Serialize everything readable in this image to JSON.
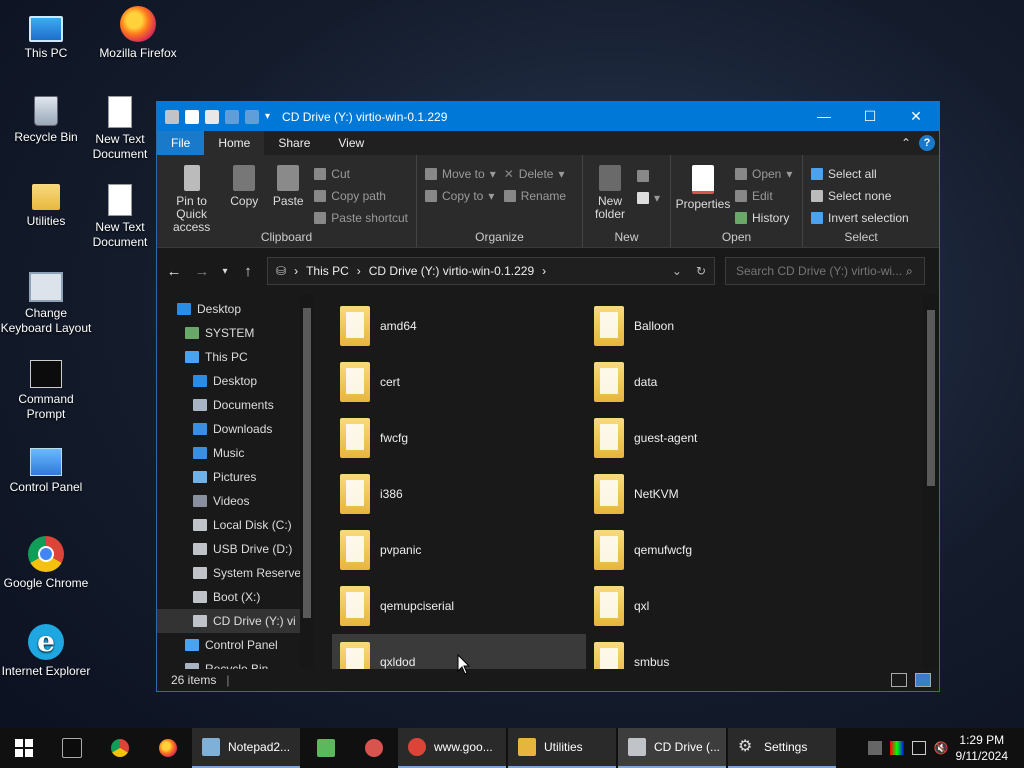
{
  "desktop": {
    "icons": [
      {
        "label": "This PC",
        "icon": "computer-icon"
      },
      {
        "label": "Mozilla Firefox",
        "icon": "firefox-icon"
      },
      {
        "label": "Recycle Bin",
        "icon": "recycle-bin-icon"
      },
      {
        "label": "New Text Document",
        "icon": "text-document-icon"
      },
      {
        "label": "Utilities",
        "icon": "folder-icon"
      },
      {
        "label": "New Text Document",
        "icon": "text-document-icon"
      },
      {
        "label": "Change Keyboard Layout",
        "icon": "keyboard-settings-icon"
      },
      {
        "label": "Command Prompt",
        "icon": "command-prompt-icon"
      },
      {
        "label": "Control Panel",
        "icon": "control-panel-icon"
      },
      {
        "label": "Google Chrome",
        "icon": "chrome-icon"
      },
      {
        "label": "Internet Explorer",
        "icon": "internet-explorer-icon"
      }
    ]
  },
  "window": {
    "title": "CD Drive (Y:) virtio-win-0.1.229",
    "tabs": [
      "File",
      "Home",
      "Share",
      "View"
    ],
    "help": "?",
    "ribbon": {
      "clipboard": {
        "label": "Clipboard",
        "pin": "Pin to Quick access",
        "copy": "Copy",
        "paste": "Paste",
        "cut": "Cut",
        "copy_path": "Copy path",
        "paste_shortcut": "Paste shortcut"
      },
      "organize": {
        "label": "Organize",
        "move_to": "Move to",
        "copy_to": "Copy to",
        "delete": "Delete",
        "rename": "Rename"
      },
      "new": {
        "label": "New",
        "new_folder": "New folder"
      },
      "open": {
        "label": "Open",
        "properties": "Properties",
        "open": "Open",
        "edit": "Edit",
        "history": "History"
      },
      "select": {
        "label": "Select",
        "select_all": "Select all",
        "select_none": "Select none",
        "invert": "Invert selection"
      }
    },
    "address": {
      "path": [
        "This PC",
        "CD Drive (Y:) virtio-win-0.1.229"
      ],
      "search_placeholder": "Search CD Drive (Y:) virtio-wi..."
    },
    "nav": [
      {
        "label": "Desktop",
        "level": 0,
        "color": "#2b8ce6"
      },
      {
        "label": "SYSTEM",
        "level": 1,
        "color": "#6aa86a"
      },
      {
        "label": "This PC",
        "level": 1,
        "color": "#4aa3f0"
      },
      {
        "label": "Desktop",
        "level": 2,
        "color": "#2b8ce6"
      },
      {
        "label": "Documents",
        "level": 2,
        "color": "#a8b4c4"
      },
      {
        "label": "Downloads",
        "level": 2,
        "color": "#3a8fe0"
      },
      {
        "label": "Music",
        "level": 2,
        "color": "#3a8fe0"
      },
      {
        "label": "Pictures",
        "level": 2,
        "color": "#6fb2e8"
      },
      {
        "label": "Videos",
        "level": 2,
        "color": "#8a8fa0"
      },
      {
        "label": "Local Disk (C:)",
        "level": 2,
        "color": "#c0c4c8"
      },
      {
        "label": "USB Drive (D:)",
        "level": 2,
        "color": "#c0c4c8"
      },
      {
        "label": "System Reserve",
        "level": 2,
        "color": "#c0c4c8"
      },
      {
        "label": "Boot (X:)",
        "level": 2,
        "color": "#c0c4c8"
      },
      {
        "label": "CD Drive (Y:) vi",
        "level": 2,
        "color": "#c0c4c8",
        "selected": true
      },
      {
        "label": "Control Panel",
        "level": 1,
        "color": "#4aa3f0"
      },
      {
        "label": "Recycle Bin",
        "level": 1,
        "color": "#a8b4c4"
      }
    ],
    "files": [
      "amd64",
      "Balloon",
      "cert",
      "data",
      "fwcfg",
      "guest-agent",
      "i386",
      "NetKVM",
      "pvpanic",
      "qemufwcfg",
      "qemupciserial",
      "qxl",
      "qxldod",
      "smbus"
    ],
    "status": "26 items"
  },
  "taskbar": {
    "apps": [
      {
        "label": "Notepad2...",
        "color": "#7fb0d8"
      },
      {
        "label": "www.goo...",
        "color": "#db4437"
      },
      {
        "label": "Utilities",
        "color": "#e7b53d"
      },
      {
        "label": "CD Drive (...",
        "color": "#c0c4c8",
        "active": true
      },
      {
        "label": "Settings",
        "color": "#cccccc"
      }
    ],
    "time": "1:29 PM",
    "date": "9/11/2024"
  },
  "colors": {
    "accent": "#0078d7",
    "ribbon": "#2b2b2b",
    "background": "#191919"
  }
}
